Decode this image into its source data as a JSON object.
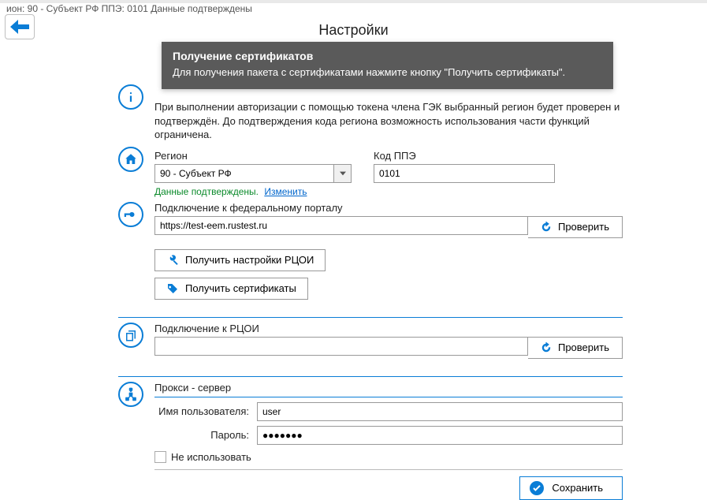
{
  "status_strip": "ион: 90 - Субъект РФ   ППЭ: 0101   Данные подтверждены",
  "title": "Настройки",
  "tooltip": {
    "title": "Получение сертификатов",
    "text": "Для получения пакета с сертификатами нажмите кнопку \"Получить сертификаты\"."
  },
  "info_text": "При выполнении авторизации с помощью токена члена ГЭК выбранный регион будет проверен и подтверждён. До подтверждения кода региона возможность использования части функций ограничена.",
  "region": {
    "label": "Регион",
    "value": "90 - Субъект РФ",
    "confirm_ok": "Данные подтверждены.",
    "confirm_change": "Изменить"
  },
  "ppe": {
    "label": "Код ППЭ",
    "value": "0101"
  },
  "federal": {
    "label": "Подключение к федеральному порталу",
    "url": "https://test-eem.rustest.ru",
    "check": "Проверить"
  },
  "actions": {
    "get_settings": "Получить настройки РЦОИ",
    "get_certs": "Получить сертификаты"
  },
  "rcoi": {
    "label": "Подключение к РЦОИ",
    "value": "",
    "check": "Проверить"
  },
  "proxy": {
    "heading": "Прокси - сервер",
    "user_label": "Имя пользователя:",
    "user_value": "user",
    "pass_label": "Пароль:",
    "pass_value": "●●●●●●●",
    "dont_use": "Не использовать"
  },
  "save": "Сохранить"
}
